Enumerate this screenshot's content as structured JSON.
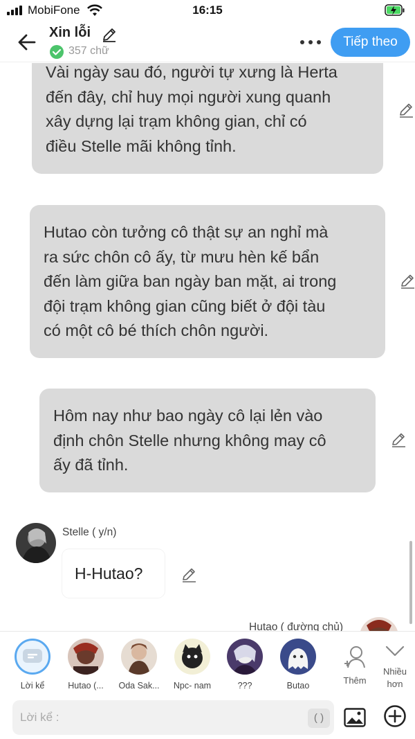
{
  "status": {
    "carrier": "MobiFone",
    "time": "16:15"
  },
  "header": {
    "title": "Xin lỗi",
    "word_count": "357 chữ",
    "next_label": "Tiếp theo"
  },
  "messages": {
    "narration_1": [
      "Vài ngày sau đó, người tự xưng là Herta",
      "đến đây, chỉ huy mọi người xung quanh",
      "xây dựng lại trạm không gian, chỉ có",
      "điều Stelle mãi không tỉnh."
    ],
    "narration_2": [
      "Hutao còn tưởng cô thật sự an nghỉ mà",
      "ra sức chôn cô ấy, từ mưu hèn kế bẩn",
      "đến làm giữa ban ngày ban mặt, ai trong",
      "đội trạm không gian cũng biết ở đội tàu",
      "có một cô bé thích chôn người."
    ],
    "narration_3": [
      "Hôm nay như bao ngày cô lại lẻn vào",
      "định chôn Stelle nhưng không may cô",
      "ấy đã tỉnh."
    ],
    "dialog_1": {
      "character": "Stelle ( y/n)",
      "text": "H-Hutao?"
    },
    "dialog_2_character": "Hutao ( đường chủ)"
  },
  "characters": [
    {
      "label": "Lời kể"
    },
    {
      "label": "Hutao (..."
    },
    {
      "label": "Oda Sak..."
    },
    {
      "label": "Npc- nam"
    },
    {
      "label": "???"
    },
    {
      "label": "Butao"
    }
  ],
  "actions": {
    "add_label": "Thêm",
    "more_label": "Nhiều hơn",
    "input_placeholder": "Lời kể :",
    "paren_label": "( )"
  },
  "colors": {
    "accent": "#3f9df2",
    "bubble": "#dadada",
    "check": "#4cc46b"
  }
}
